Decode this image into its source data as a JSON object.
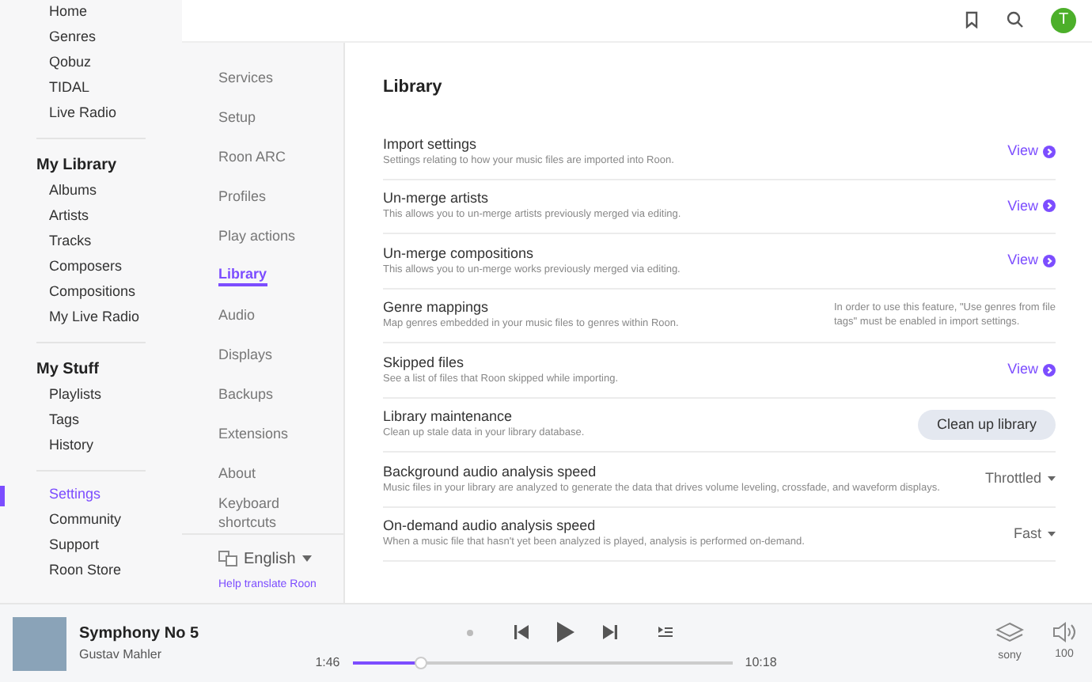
{
  "sidebar": {
    "top_items": [
      {
        "label": "Home",
        "selected": false
      },
      {
        "label": "Genres",
        "selected": false
      },
      {
        "label": "Qobuz",
        "selected": false
      },
      {
        "label": "TIDAL",
        "selected": false
      },
      {
        "label": "Live Radio",
        "selected": false
      }
    ],
    "sections": [
      {
        "title": "My Library",
        "items": [
          {
            "label": "Albums",
            "selected": false
          },
          {
            "label": "Artists",
            "selected": false
          },
          {
            "label": "Tracks",
            "selected": false
          },
          {
            "label": "Composers",
            "selected": false
          },
          {
            "label": "Compositions",
            "selected": false
          },
          {
            "label": "My Live Radio",
            "selected": false
          }
        ]
      },
      {
        "title": "My Stuff",
        "items": [
          {
            "label": "Playlists",
            "selected": false
          },
          {
            "label": "Tags",
            "selected": false
          },
          {
            "label": "History",
            "selected": false
          }
        ]
      }
    ],
    "bottom_items": [
      {
        "label": "Settings",
        "selected": true
      },
      {
        "label": "Community",
        "selected": false
      },
      {
        "label": "Support",
        "selected": false
      },
      {
        "label": "Roon Store",
        "selected": false
      }
    ]
  },
  "topbar": {
    "avatar": "T"
  },
  "settings_nav": {
    "items": [
      {
        "label": "Services",
        "selected": false
      },
      {
        "label": "Setup",
        "selected": false
      },
      {
        "label": "Roon ARC",
        "selected": false
      },
      {
        "label": "Profiles",
        "selected": false
      },
      {
        "label": "Play actions",
        "selected": false
      },
      {
        "label": "Library",
        "selected": true
      },
      {
        "label": "Audio",
        "selected": false
      },
      {
        "label": "Displays",
        "selected": false
      },
      {
        "label": "Backups",
        "selected": false
      },
      {
        "label": "Extensions",
        "selected": false
      },
      {
        "label": "About",
        "selected": false
      },
      {
        "label": "Keyboard shortcuts",
        "selected": false
      }
    ],
    "language": "English",
    "help_link": "Help translate Roon"
  },
  "content": {
    "title": "Library",
    "rows": [
      {
        "title": "Import settings",
        "description": "Settings relating to how your music files are imported into Roon.",
        "kind": "link",
        "action": "View"
      },
      {
        "title": "Un-merge artists",
        "description": "This allows you to un-merge artists previously merged via editing.",
        "kind": "link",
        "action": "View"
      },
      {
        "title": "Un-merge compositions",
        "description": "This allows you to un-merge works previously merged via editing.",
        "kind": "link",
        "action": "View"
      },
      {
        "title": "Genre mappings",
        "description": "Map genres embedded in your music files to genres within Roon.",
        "kind": "note",
        "action": "In order to use this feature, \"Use genres from file tags\" must be enabled in import settings."
      },
      {
        "title": "Skipped files",
        "description": "See a list of files that Roon skipped while importing.",
        "kind": "link",
        "action": "View"
      },
      {
        "title": "Library maintenance",
        "description": "Clean up stale data in your library database.",
        "kind": "button",
        "action": "Clean up library"
      },
      {
        "title": "Background audio analysis speed",
        "description": "Music files in your library are analyzed to generate the data that drives volume leveling, crossfade, and waveform displays.",
        "kind": "dropdown",
        "action": "Throttled"
      },
      {
        "title": "On-demand audio analysis speed",
        "description": "When a music file that hasn't yet been analyzed is played, analysis is performed on-demand.",
        "kind": "dropdown",
        "action": "Fast"
      }
    ]
  },
  "player": {
    "track": "Symphony No 5",
    "artist": "Gustav Mahler",
    "elapsed": "1:46",
    "duration": "10:18",
    "level": 0.18,
    "zone": "sony",
    "volume": "100"
  }
}
